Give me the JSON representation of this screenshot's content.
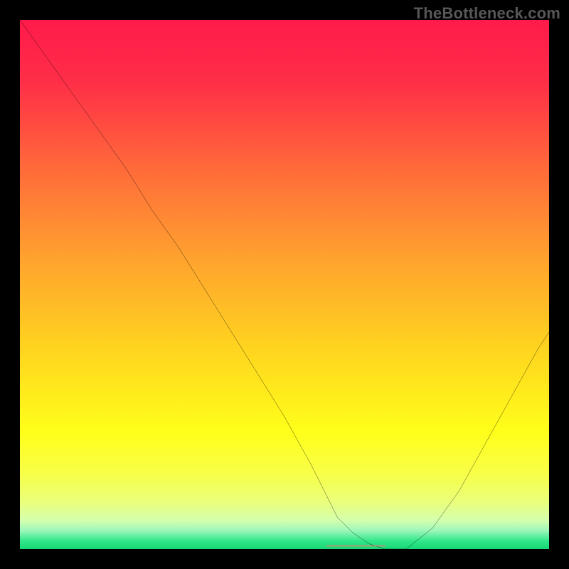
{
  "watermark": "TheBottleneck.com",
  "colors": {
    "frame": "#000000",
    "curve": "#000000",
    "flat_segment": "#e27a74",
    "gradient_stops": [
      {
        "offset": 0.0,
        "color": "#ff1a4b"
      },
      {
        "offset": 0.12,
        "color": "#ff2f47"
      },
      {
        "offset": 0.28,
        "color": "#ff6a3a"
      },
      {
        "offset": 0.45,
        "color": "#ffa22e"
      },
      {
        "offset": 0.62,
        "color": "#ffd41f"
      },
      {
        "offset": 0.78,
        "color": "#ffff1a"
      },
      {
        "offset": 0.86,
        "color": "#f7ff4a"
      },
      {
        "offset": 0.91,
        "color": "#eaff7a"
      },
      {
        "offset": 0.945,
        "color": "#d6ffad"
      },
      {
        "offset": 0.965,
        "color": "#9cf7b9"
      },
      {
        "offset": 0.985,
        "color": "#2fe68a"
      },
      {
        "offset": 1.0,
        "color": "#18d873"
      }
    ]
  },
  "chart_data": {
    "type": "line",
    "title": "",
    "xlabel": "",
    "ylabel": "",
    "xlim": [
      0,
      100
    ],
    "ylim": [
      0,
      100
    ],
    "series": [
      {
        "name": "bottleneck-curve",
        "x": [
          0,
          5,
          10,
          15,
          20,
          25,
          30,
          35,
          40,
          45,
          50,
          55,
          58,
          60,
          63,
          66,
          69,
          70,
          73,
          78,
          83,
          88,
          93,
          98,
          100
        ],
        "y": [
          100,
          93,
          86,
          79,
          72,
          64,
          57,
          49,
          41,
          33,
          25,
          16,
          10,
          6,
          3,
          1,
          0,
          0,
          0,
          4,
          11,
          20,
          29,
          38,
          41
        ]
      }
    ],
    "flat_region": {
      "x_start": 58,
      "x_end": 69,
      "y": 0.6
    }
  }
}
